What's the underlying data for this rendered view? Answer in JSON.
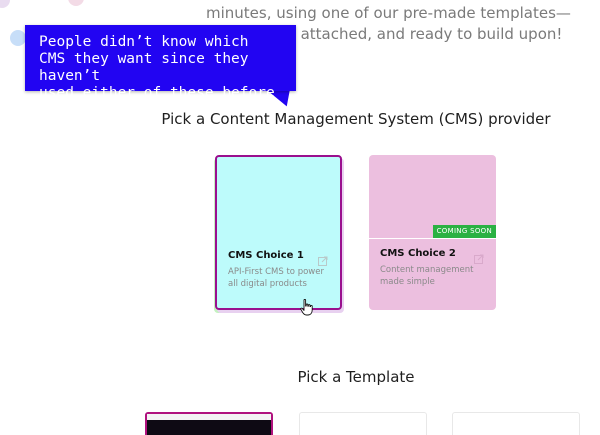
{
  "intro": {
    "line1": "minutes, using one of our pre-made templates—",
    "line2": "s attached, and ready to build upon!"
  },
  "annotation": {
    "text": "People didn’t know which\nCMS they want since they haven’t\nused either of these before",
    "color": "#2204f2"
  },
  "cms_section": {
    "title": "Pick a Content Management System (CMS) provider",
    "cards": [
      {
        "title": "CMS Choice 1",
        "description": "API-First CMS to power all digital products",
        "icon": "external-link-icon",
        "selected": true,
        "color": "#bdfbfb"
      },
      {
        "title": "CMS Choice 2",
        "description": "Content management made simple",
        "badge": "COMING SOON",
        "icon": "external-link-icon",
        "selected": false,
        "color": "#ecbfdf"
      }
    ]
  },
  "template_section": {
    "title": "Pick a Template"
  },
  "colors": {
    "selected_border": "#9a0f8e",
    "badge": "#2bb143"
  }
}
